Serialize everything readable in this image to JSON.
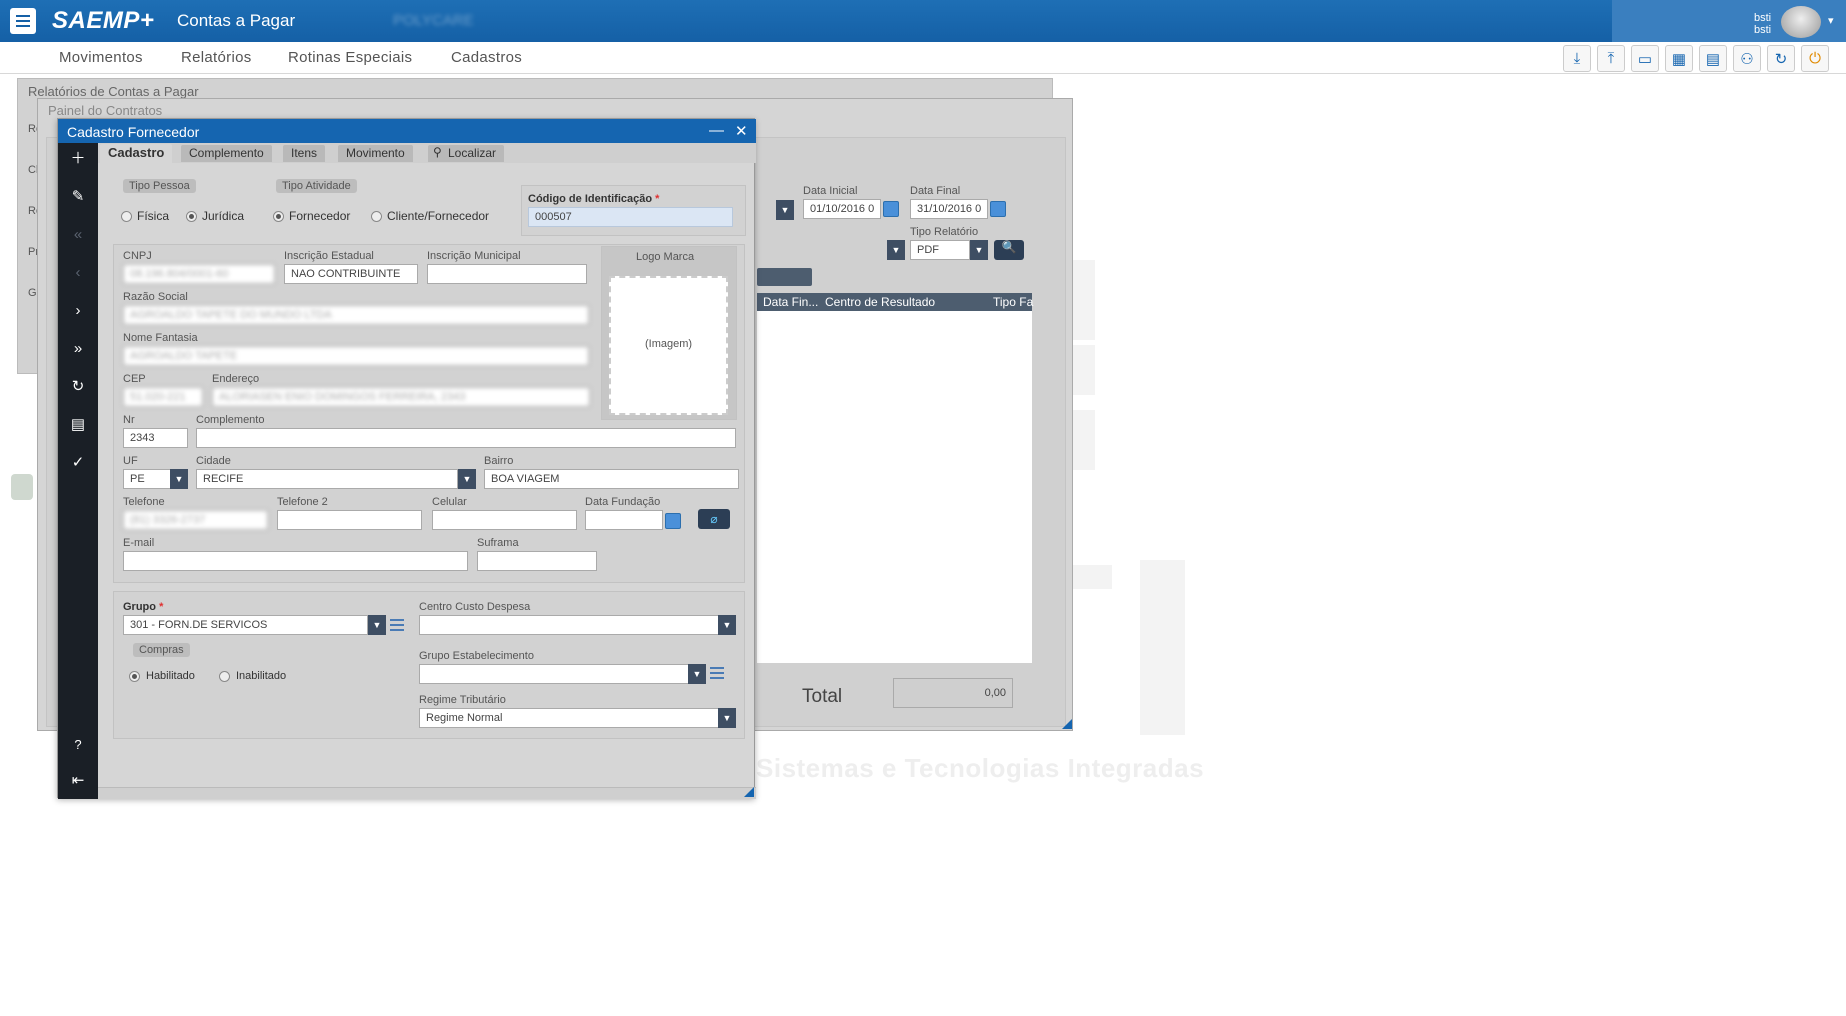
{
  "app": {
    "logo": "SAEMP+",
    "title": "Contas a Pagar",
    "company": "POLYCARE"
  },
  "user": {
    "line1": "bsti",
    "line2": "bsti"
  },
  "menu": [
    "Movimentos",
    "Relatórios",
    "Rotinas Especiais",
    "Cadastros"
  ],
  "toolbar_icons": [
    "download-icon",
    "upload-icon",
    "monitor-icon",
    "grid-icon",
    "layout-icon",
    "users-icon",
    "refresh-icon",
    "power-icon"
  ],
  "watermark": "Sistemas e Tecnologias Integradas",
  "bg_window1": {
    "title": "Relatórios de Contas a Pagar",
    "labels": [
      "Re",
      "Cl",
      "Re",
      "Pr",
      "Gr"
    ]
  },
  "bg_window2": {
    "title": "Painel do Contratos",
    "data_inicial_label": "Data Inicial",
    "data_inicial": "01/10/2016 0",
    "data_final_label": "Data Final",
    "data_final": "31/10/2016 0",
    "tipo_relatorio_label": "Tipo Relatório",
    "tipo_relatorio": "PDF",
    "columns": [
      "Data Fin...",
      "Centro de Resultado",
      "Tipo Fa"
    ],
    "total_label": "Total",
    "total_value": "0,00"
  },
  "dialog": {
    "title": "Cadastro Fornecedor",
    "tabs": [
      "Cadastro",
      "Complemento",
      "Itens",
      "Movimento",
      "Localizar"
    ],
    "tipo_pessoa": {
      "label": "Tipo Pessoa",
      "options": [
        "Física",
        "Jurídica"
      ],
      "selected": "Jurídica"
    },
    "tipo_atividade": {
      "label": "Tipo Atividade",
      "options": [
        "Fornecedor",
        "Cliente/Fornecedor"
      ],
      "selected": "Fornecedor"
    },
    "codigo": {
      "label": "Código de Identificação",
      "value": "000507"
    },
    "cnpj": {
      "label": "CNPJ",
      "value": "08.196.804/0001-60"
    },
    "insc_estadual": {
      "label": "Inscrição Estadual",
      "value": "NAO CONTRIBUINTE"
    },
    "insc_municipal": {
      "label": "Inscrição Municipal",
      "value": ""
    },
    "logo_marca": {
      "label": "Logo Marca",
      "placeholder": "(Imagem)"
    },
    "razao_social": {
      "label": "Razão Social",
      "value": "AGROALDO TAPETE DO MUNDO LTDA"
    },
    "nome_fantasia": {
      "label": "Nome Fantasia",
      "value": "AGROALDO TAPETE"
    },
    "cep": {
      "label": "CEP",
      "value": "51.020-221"
    },
    "endereco": {
      "label": "Endereço",
      "value": "ALORIASEN ENIO DOMINGOS FERREIRA, 2343"
    },
    "nr": {
      "label": "Nr",
      "value": "2343"
    },
    "complemento": {
      "label": "Complemento",
      "value": ""
    },
    "uf": {
      "label": "UF",
      "value": "PE"
    },
    "cidade": {
      "label": "Cidade",
      "value": "RECIFE"
    },
    "bairro": {
      "label": "Bairro",
      "value": "BOA VIAGEM"
    },
    "telefone": {
      "label": "Telefone",
      "value": "(81) 3326-2737"
    },
    "telefone2": {
      "label": "Telefone 2",
      "value": ""
    },
    "celular": {
      "label": "Celular",
      "value": ""
    },
    "data_fundacao": {
      "label": "Data Fundação",
      "value": ""
    },
    "email": {
      "label": "E-mail",
      "value": ""
    },
    "suframa": {
      "label": "Suframa",
      "value": ""
    },
    "grupo": {
      "label": "Grupo",
      "value": "301 - FORN.DE SERVICOS"
    },
    "compras": {
      "label": "Compras",
      "options": [
        "Habilitado",
        "Inabilitado"
      ],
      "selected": "Habilitado"
    },
    "centro_custo": {
      "label": "Centro Custo Despesa",
      "value": ""
    },
    "grupo_estab": {
      "label": "Grupo Estabelecimento",
      "value": ""
    },
    "regime": {
      "label": "Regime Tributário",
      "value": "Regime Normal"
    }
  }
}
